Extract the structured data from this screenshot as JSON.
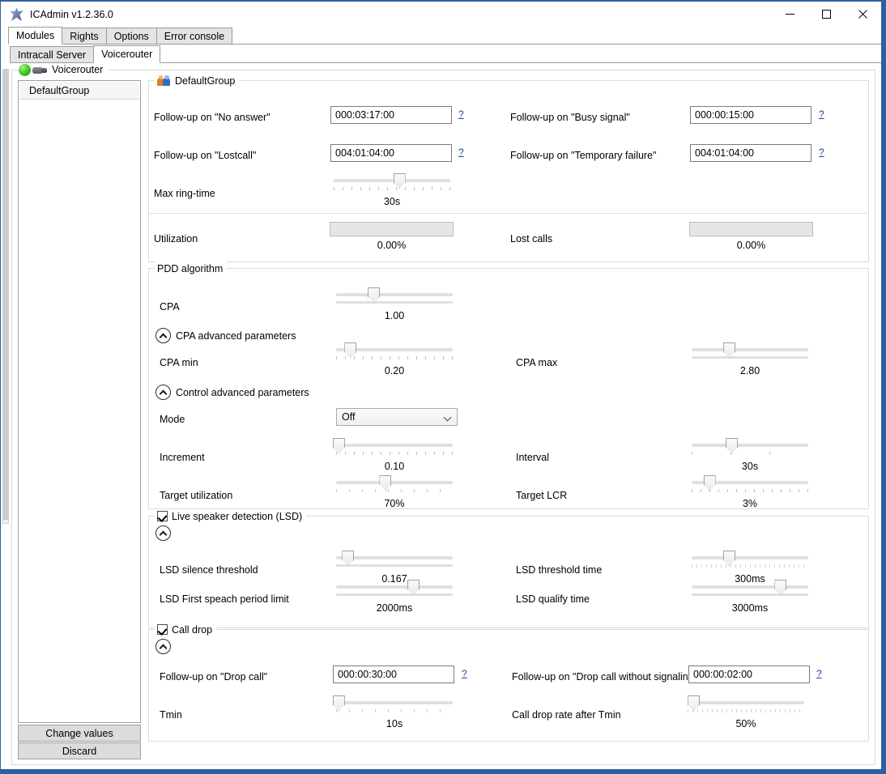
{
  "window": {
    "title": "ICAdmin v1.2.36.0",
    "icon": "app-star-icon",
    "minimize": "–",
    "maximize": "□",
    "close": "✕",
    "border_color": "#2f5f9e"
  },
  "tabs_primary": [
    {
      "label": "Modules",
      "active": true
    },
    {
      "label": "Rights",
      "active": false
    },
    {
      "label": "Options",
      "active": false
    },
    {
      "label": "Error console",
      "active": false
    }
  ],
  "tabs_secondary": [
    {
      "label": "Intracall Server",
      "active": false
    },
    {
      "label": "Voicerouter",
      "active": true
    }
  ],
  "status_group": {
    "title": "Voicerouter",
    "led_color": "#46cc2c"
  },
  "group_list": {
    "items": [
      {
        "label": "DefaultGroup",
        "selected": true
      }
    ]
  },
  "buttons": {
    "change_values": "Change values",
    "discard": "Discard"
  },
  "default_group": {
    "legend": "DefaultGroup",
    "fields": [
      {
        "label": "Follow-up on \"No answer\"",
        "value": "000:03:17:00",
        "help": "?"
      },
      {
        "label": "Follow-up on \"Busy signal\"",
        "value": "000:00:15:00",
        "help": "?"
      },
      {
        "label": "Follow-up on \"Lostcall\"",
        "value": "004:01:04:00",
        "help": "?"
      },
      {
        "label": "Follow-up on \"Temporary failure\"",
        "value": "004:01:04:00",
        "help": "?"
      }
    ],
    "max_ring_time": {
      "label": "Max ring-time",
      "value": "30s",
      "percent": 56
    },
    "utilization": {
      "label": "Utilization",
      "value": "0.00%",
      "percent": 0
    },
    "lost_calls": {
      "label": "Lost calls",
      "value": "0.00%",
      "percent": 0
    }
  },
  "pdd": {
    "legend": "PDD algorithm",
    "cpa": {
      "label": "CPA",
      "value": "1.00",
      "percent": 32
    },
    "cpa_advanced": {
      "label": "CPA advanced parameters",
      "expanded": true
    },
    "cpa_min": {
      "label": "CPA min",
      "value": "0.20",
      "percent": 12
    },
    "cpa_max": {
      "label": "CPA max",
      "value": "2.80",
      "percent": 32
    },
    "control_advanced": {
      "label": "Control advanced parameters",
      "expanded": true
    },
    "mode": {
      "label": "Mode",
      "value": "Off",
      "options": [
        "Off"
      ]
    },
    "increment": {
      "label": "Increment",
      "value": "0.10",
      "percent": 2
    },
    "interval": {
      "label": "Interval",
      "value": "30s",
      "percent": 34
    },
    "target_utilization": {
      "label": "Target utilization",
      "value": "70%",
      "percent": 42
    },
    "target_lcr": {
      "label": "Target LCR",
      "value": "3%",
      "percent": 15
    }
  },
  "lsd": {
    "legend": "Live speaker detection (LSD)",
    "checked": true,
    "expanded": true,
    "silence_threshold": {
      "label": "LSD silence threshold",
      "value": "0.167",
      "percent": 10
    },
    "threshold_time": {
      "label": "LSD threshold time",
      "value": "300ms",
      "percent": 32
    },
    "first_speach_period_limit": {
      "label": "LSD First speach period limit",
      "value": "2000ms",
      "percent": 66
    },
    "qualify_time": {
      "label": "LSD qualify time",
      "value": "3000ms",
      "percent": 76
    }
  },
  "call_drop": {
    "legend": "Call drop",
    "checked": true,
    "expanded": true,
    "drop_call": {
      "label": "Follow-up on \"Drop call\"",
      "value": "000:00:30:00",
      "help": "?"
    },
    "drop_call_no_signal": {
      "label": "Follow-up on \"Drop call without signalin",
      "value": "000:00:02:00",
      "help": "?"
    },
    "tmin": {
      "label": "Tmin",
      "value": "10s",
      "percent": 2
    },
    "call_drop_rate": {
      "label": "Call drop rate after Tmin",
      "value": "50%",
      "percent": 5
    }
  }
}
